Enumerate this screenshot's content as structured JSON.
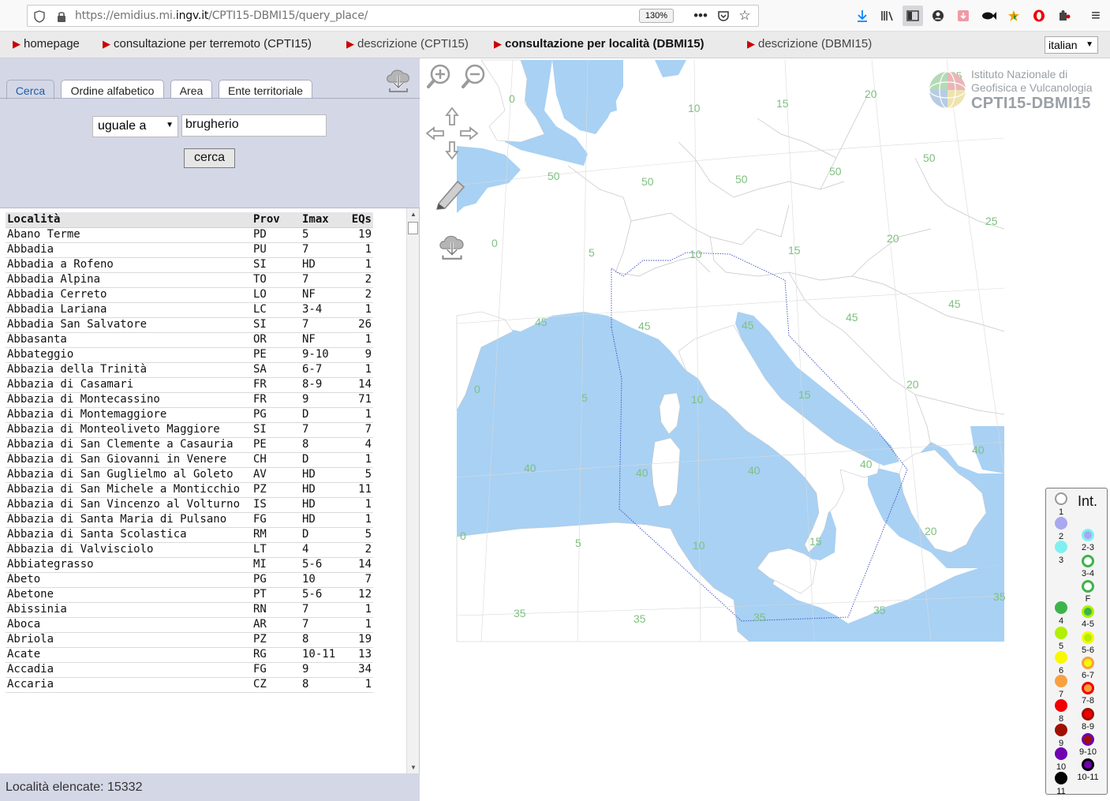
{
  "browser": {
    "url_prefix": "https://emidius.mi.",
    "url_domain": "ingv.it",
    "url_path": "/CPTI15-DBMI15/query_place/",
    "zoom": "130%"
  },
  "nav": {
    "items": [
      {
        "label": "homepage"
      },
      {
        "label": "consultazione per terremoto (CPTI15)"
      },
      {
        "label": "descrizione (CPTI15)"
      },
      {
        "label": "consultazione per località (DBMI15)"
      },
      {
        "label": "descrizione (DBMI15)"
      }
    ],
    "language": "italian"
  },
  "search": {
    "tabs": [
      {
        "label": "Cerca"
      },
      {
        "label": "Ordine alfabetico"
      },
      {
        "label": "Area"
      },
      {
        "label": "Ente territoriale"
      }
    ],
    "operator": "uguale a",
    "query": "brugherio",
    "button": "cerca"
  },
  "table": {
    "headers": {
      "place": "Località",
      "prov": "Prov",
      "imax": "Imax",
      "eqs": "EQs"
    },
    "rows": [
      {
        "place": "Abano Terme",
        "prov": "PD",
        "imax": "5",
        "eqs": "19"
      },
      {
        "place": "Abbadia",
        "prov": "PU",
        "imax": "7",
        "eqs": "1"
      },
      {
        "place": "Abbadia a Rofeno",
        "prov": "SI",
        "imax": "HD",
        "eqs": "1"
      },
      {
        "place": "Abbadia Alpina",
        "prov": "TO",
        "imax": "7",
        "eqs": "2"
      },
      {
        "place": "Abbadia Cerreto",
        "prov": "LO",
        "imax": "NF",
        "eqs": "2"
      },
      {
        "place": "Abbadia Lariana",
        "prov": "LC",
        "imax": "3-4",
        "eqs": "1"
      },
      {
        "place": "Abbadia San Salvatore",
        "prov": "SI",
        "imax": "7",
        "eqs": "26"
      },
      {
        "place": "Abbasanta",
        "prov": "OR",
        "imax": "NF",
        "eqs": "1"
      },
      {
        "place": "Abbateggio",
        "prov": "PE",
        "imax": "9-10",
        "eqs": "9"
      },
      {
        "place": "Abbazia della Trinità",
        "prov": "SA",
        "imax": "6-7",
        "eqs": "1"
      },
      {
        "place": "Abbazia di Casamari",
        "prov": "FR",
        "imax": "8-9",
        "eqs": "14"
      },
      {
        "place": "Abbazia di Montecassino",
        "prov": "FR",
        "imax": "9",
        "eqs": "71"
      },
      {
        "place": "Abbazia di Montemaggiore",
        "prov": "PG",
        "imax": "D",
        "eqs": "1"
      },
      {
        "place": "Abbazia di Monteoliveto Maggiore",
        "prov": "SI",
        "imax": "7",
        "eqs": "7"
      },
      {
        "place": "Abbazia di San Clemente a Casauria",
        "prov": "PE",
        "imax": "8",
        "eqs": "4"
      },
      {
        "place": "Abbazia di San Giovanni in Venere",
        "prov": "CH",
        "imax": "D",
        "eqs": "1"
      },
      {
        "place": "Abbazia di San Guglielmo al Goleto",
        "prov": "AV",
        "imax": "HD",
        "eqs": "5"
      },
      {
        "place": "Abbazia di San Michele a Monticchio",
        "prov": "PZ",
        "imax": "HD",
        "eqs": "11"
      },
      {
        "place": "Abbazia di San Vincenzo al Volturno",
        "prov": "IS",
        "imax": "HD",
        "eqs": "1"
      },
      {
        "place": "Abbazia di Santa Maria di Pulsano",
        "prov": "FG",
        "imax": "HD",
        "eqs": "1"
      },
      {
        "place": "Abbazia di Santa Scolastica",
        "prov": "RM",
        "imax": "D",
        "eqs": "5"
      },
      {
        "place": "Abbazia di Valvisciolo",
        "prov": "LT",
        "imax": "4",
        "eqs": "2"
      },
      {
        "place": "Abbiategrasso",
        "prov": "MI",
        "imax": "5-6",
        "eqs": "14"
      },
      {
        "place": "Abeto",
        "prov": "PG",
        "imax": "10",
        "eqs": "7"
      },
      {
        "place": "Abetone",
        "prov": "PT",
        "imax": "5-6",
        "eqs": "12"
      },
      {
        "place": "Abissinia",
        "prov": "RN",
        "imax": "7",
        "eqs": "1"
      },
      {
        "place": "Aboca",
        "prov": "AR",
        "imax": "7",
        "eqs": "1"
      },
      {
        "place": "Abriola",
        "prov": "PZ",
        "imax": "8",
        "eqs": "19"
      },
      {
        "place": "Acate",
        "prov": "RG",
        "imax": "10-11",
        "eqs": "13"
      },
      {
        "place": "Accadia",
        "prov": "FG",
        "imax": "9",
        "eqs": "34"
      },
      {
        "place": "Accaria",
        "prov": "CZ",
        "imax": "8",
        "eqs": "1"
      }
    ]
  },
  "count_label": "Località elencate: 15332",
  "logo": {
    "line1": "Istituto Nazionale di",
    "line2": "Geofisica e Vulcanologia",
    "line3": "CPTI15-DBMI15"
  },
  "map": {
    "grid_labels": [
      "0",
      "10",
      "15",
      "20",
      "25",
      "50",
      "50",
      "50",
      "50",
      "50",
      "25",
      "20",
      "15",
      "10",
      "5",
      "0",
      "45",
      "45",
      "45",
      "45",
      "45",
      "0",
      "5",
      "10",
      "15",
      "20",
      "40",
      "40",
      "40",
      "40",
      "40",
      "0",
      "5",
      "10",
      "15",
      "20",
      "35",
      "35",
      "35",
      "35",
      "35"
    ]
  },
  "legend": {
    "title": "Int.",
    "single": [
      {
        "label": "1",
        "color": "#ffffff",
        "border": "#999999"
      },
      {
        "label": "2",
        "color": "#a8a8f0",
        "border": "#a8a8f0"
      },
      {
        "label": "3",
        "color": "#7ff0f0",
        "border": "#7ff0f0"
      },
      {
        "label": "4",
        "color": "#3cb44b",
        "border": "#3cb44b"
      },
      {
        "label": "5",
        "color": "#b0f000",
        "border": "#b0f000"
      },
      {
        "label": "6",
        "color": "#f8f800",
        "border": "#f8f800"
      },
      {
        "label": "7",
        "color": "#f8a040",
        "border": "#f8a040"
      },
      {
        "label": "8",
        "color": "#f00000",
        "border": "#f00000"
      },
      {
        "label": "9",
        "color": "#a01000",
        "border": "#a01000"
      },
      {
        "label": "10",
        "color": "#7000b0",
        "border": "#7000b0"
      },
      {
        "label": "11",
        "color": "#000000",
        "border": "#000000"
      }
    ],
    "double": [
      {
        "label": "2-3",
        "color": "#a8a8f0",
        "border": "#7ff0f0"
      },
      {
        "label": "3-4",
        "color": "#ffffff",
        "border": "#3cb44b"
      },
      {
        "label": "F",
        "color": "#ffffff",
        "border": "#3cb44b"
      },
      {
        "label": "4-5",
        "color": "#3cb44b",
        "border": "#b0f000"
      },
      {
        "label": "5-6",
        "color": "#b0f000",
        "border": "#f8f800"
      },
      {
        "label": "6-7",
        "color": "#f8f800",
        "border": "#f8a040"
      },
      {
        "label": "7-8",
        "color": "#f8a040",
        "border": "#f00000"
      },
      {
        "label": "8-9",
        "color": "#f00000",
        "border": "#a01000"
      },
      {
        "label": "9-10",
        "color": "#a01000",
        "border": "#7000b0"
      },
      {
        "label": "10-11",
        "color": "#7000b0",
        "border": "#000000"
      }
    ]
  }
}
